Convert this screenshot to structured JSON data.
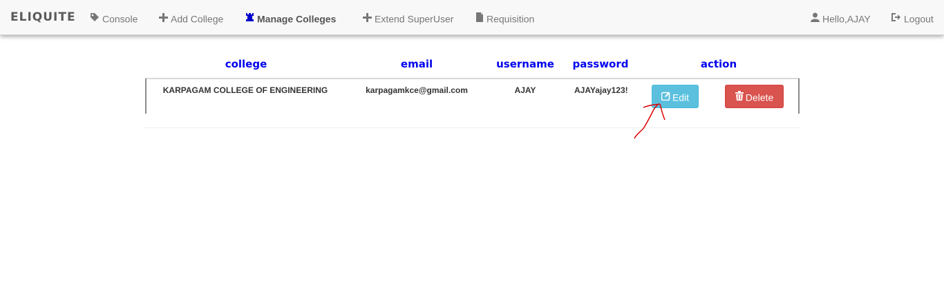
{
  "navbar": {
    "brand": "ELIQUITE",
    "items": [
      {
        "label": "Console",
        "icon": "tag-icon"
      },
      {
        "label": "Add College",
        "icon": "plus-icon"
      },
      {
        "label": "Manage Colleges",
        "icon": "chess-tower-icon",
        "active": true
      },
      {
        "label": "Extend SuperUser",
        "icon": "plus-icon"
      },
      {
        "label": "Requisition",
        "icon": "file-icon"
      }
    ],
    "user": {
      "label": "Hello,AJAY",
      "icon": "user-icon"
    },
    "logout": {
      "label": "Logout",
      "icon": "logout-icon"
    }
  },
  "table": {
    "headers": [
      "college",
      "email",
      "username",
      "password",
      "action"
    ],
    "rows": [
      {
        "college": "KARPAGAM COLLEGE OF ENGINEERING",
        "email": "karpagamkce@gmail.com",
        "username": "AJAY",
        "password": "AJAYajay123!",
        "edit_label": "Edit",
        "delete_label": "Delete"
      }
    ]
  },
  "colors": {
    "header_text": "#0000ee",
    "edit_button": "#5bc0de",
    "delete_button": "#d9534f",
    "annotation_arrow": "#dd0000"
  }
}
